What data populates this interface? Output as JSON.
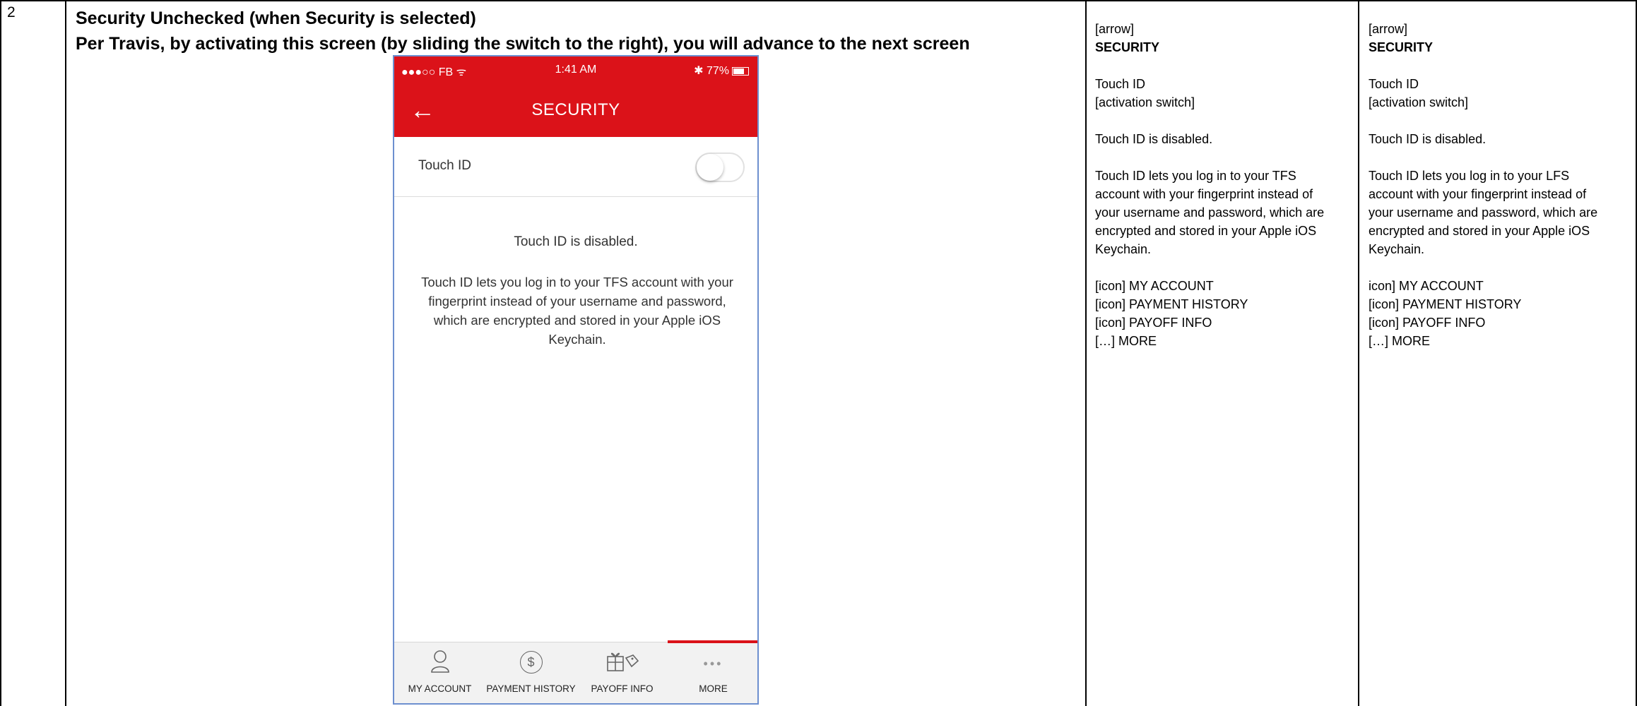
{
  "row": {
    "number": "2",
    "heading_line1": "Security Unchecked (when Security is selected)",
    "heading_line2": "Per Travis, by activating this screen (by sliding the switch to the right), you will advance to the next screen"
  },
  "phone": {
    "status_left": "●●●○○ FB ᯤ",
    "status_time": "1:41 AM",
    "status_right": "✱ 77%",
    "back_icon": "←",
    "title": "SECURITY",
    "touch_id_label": "Touch ID",
    "switch_state": "off",
    "message_title": "Touch ID is disabled.",
    "message_body": "Touch ID lets you log in to your TFS account with your fingerprint instead of your username and password, which are encrypted and stored in your Apple iOS Keychain.",
    "tabs": [
      {
        "icon": "person-icon",
        "glyph": "♙",
        "label": "MY ACCOUNT"
      },
      {
        "icon": "dollar-circle-icon",
        "glyph": "$",
        "label": "PAYMENT HISTORY"
      },
      {
        "icon": "gift-tag-icon",
        "glyph": "🎁",
        "label": "PAYOFF INFO"
      },
      {
        "icon": "more-dots-icon",
        "glyph": "•••",
        "label": "MORE"
      }
    ],
    "accent_color": "#db1219"
  },
  "notes_col1": {
    "arrow": "[arrow]",
    "title": "SECURITY",
    "touch_id": "Touch ID",
    "switch": "[activation switch]",
    "disabled": "Touch ID is disabled.",
    "body_lines": [
      "Touch ID lets you log in to your TFS",
      "account with your fingerprint instead of",
      "your username and password, which are",
      "encrypted and stored in your Apple iOS",
      "Keychain."
    ],
    "nav": [
      "[icon] MY ACCOUNT",
      "[icon] PAYMENT HISTORY",
      "[icon] PAYOFF INFO",
      "[…] MORE"
    ]
  },
  "notes_col2": {
    "arrow": "[arrow]",
    "title": "SECURITY",
    "touch_id": "Touch ID",
    "switch": "[activation switch]",
    "disabled": "Touch ID is disabled.",
    "body_lines": [
      "Touch ID lets you log in to your LFS",
      "account with your fingerprint instead of",
      "your username and password, which are",
      "encrypted and stored in your Apple iOS",
      "Keychain."
    ],
    "nav": [
      "icon] MY ACCOUNT",
      "[icon] PAYMENT HISTORY",
      "[icon] PAYOFF INFO",
      "[…] MORE"
    ]
  }
}
